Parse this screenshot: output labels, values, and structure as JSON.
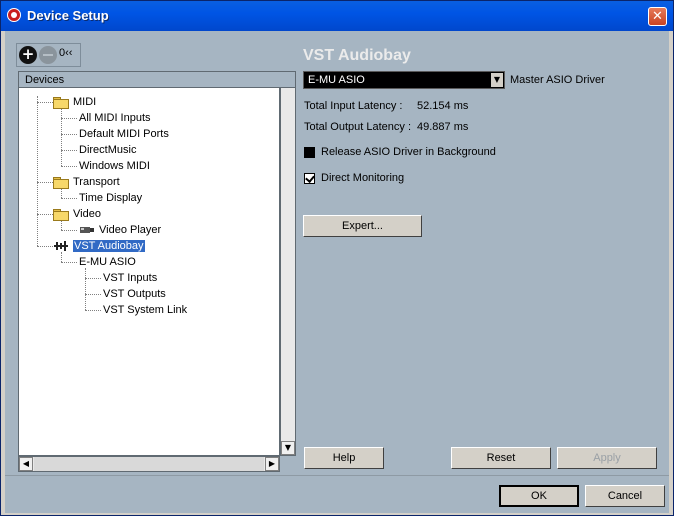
{
  "window": {
    "title": "Device Setup",
    "close_glyph": "✕"
  },
  "toolbar": {
    "add_glyph": "+",
    "collapse_label": "0‹‹"
  },
  "tree": {
    "header": "Devices",
    "items": [
      {
        "label": "MIDI",
        "type": "folder"
      },
      {
        "label": "All MIDI Inputs",
        "type": "leaf"
      },
      {
        "label": "Default MIDI Ports",
        "type": "leaf"
      },
      {
        "label": "DirectMusic",
        "type": "leaf"
      },
      {
        "label": "Windows MIDI",
        "type": "leaf"
      },
      {
        "label": "Transport",
        "type": "folder"
      },
      {
        "label": "Time Display",
        "type": "leaf"
      },
      {
        "label": "Video",
        "type": "folder"
      },
      {
        "label": "Video Player",
        "type": "device"
      },
      {
        "label": "VST Audiobay",
        "type": "device",
        "selected": true
      },
      {
        "label": "E-MU ASIO",
        "type": "leaf"
      },
      {
        "label": "VST Inputs",
        "type": "leaf"
      },
      {
        "label": "VST Outputs",
        "type": "leaf"
      },
      {
        "label": "VST System Link",
        "type": "leaf"
      }
    ]
  },
  "panel": {
    "title": "VST Audiobay",
    "driver": {
      "value": "E-MU ASIO",
      "label": "Master ASIO Driver"
    },
    "latency": {
      "input_label": "Total Input Latency :",
      "input_value": "52.154 ms",
      "output_label": "Total Output Latency :",
      "output_value": "49.887 ms"
    },
    "release_driver": {
      "label": "Release ASIO Driver in Background",
      "checked": false
    },
    "direct_monitoring": {
      "label": "Direct Monitoring",
      "checked": true
    },
    "expert_label": "Expert..."
  },
  "buttons": {
    "help": "Help",
    "reset": "Reset",
    "apply": "Apply",
    "ok": "OK",
    "cancel": "Cancel"
  },
  "colors": {
    "titlebar": "#0055e5",
    "client_bg": "#a6b5c2",
    "selection": "#316ac5"
  }
}
